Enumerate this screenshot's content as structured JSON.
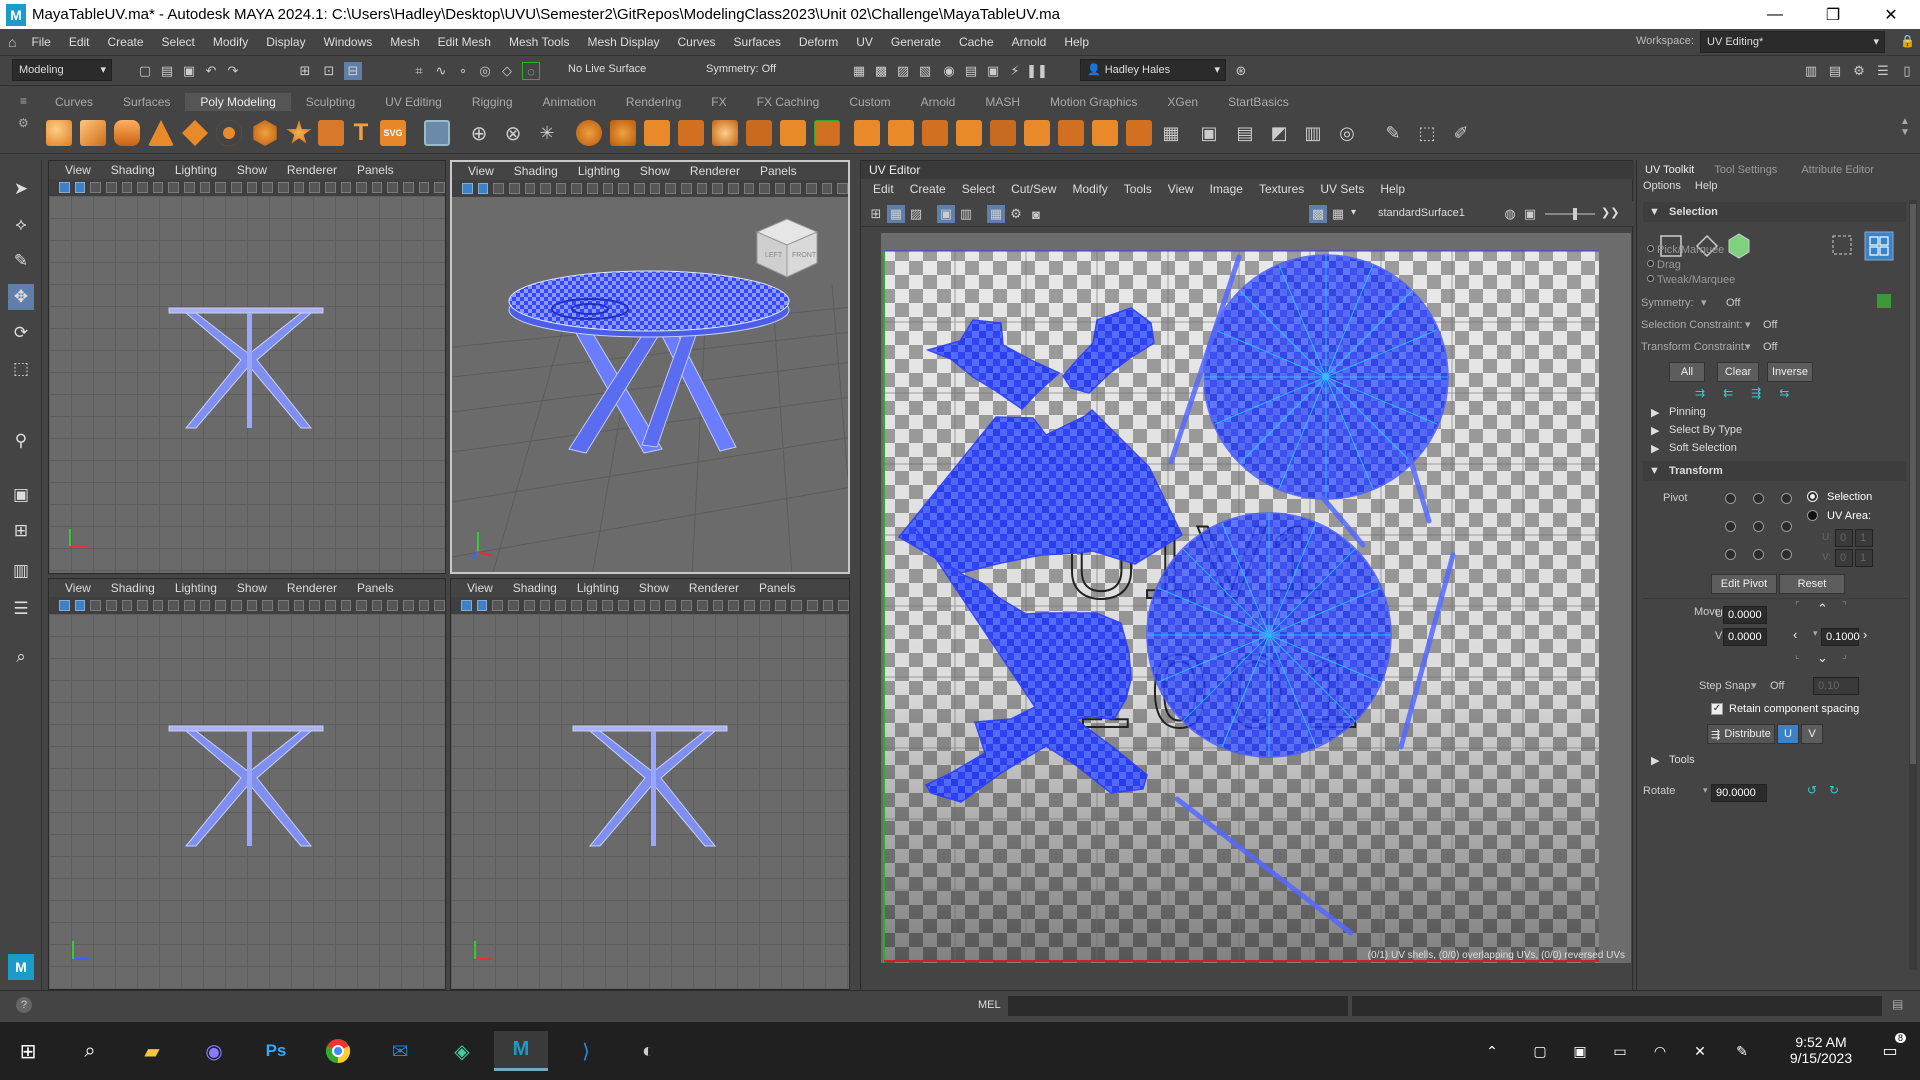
{
  "titlebar": {
    "title": "MayaTableUV.ma* - Autodesk MAYA 2024.1: C:\\Users\\Hadley\\Desktop\\UVU\\Semester2\\GitRepos\\ModelingClass2023\\Unit 02\\Challenge\\MayaTableUV.ma",
    "logo": "M",
    "minimize": "—",
    "restore": "❐",
    "close": "✕"
  },
  "menubar": {
    "items": [
      "File",
      "Edit",
      "Create",
      "Select",
      "Modify",
      "Display",
      "Windows",
      "Mesh",
      "Edit Mesh",
      "Mesh Tools",
      "Mesh Display",
      "Curves",
      "Surfaces",
      "Deform",
      "UV",
      "Generate",
      "Cache",
      "Arnold",
      "Help"
    ],
    "workspace_label": "Workspace:",
    "workspace_value": "UV Editing*"
  },
  "statusline": {
    "menuset": "Modeling",
    "live_surface": "No Live Surface",
    "symmetry": "Symmetry: Off",
    "user": "Hadley Hales"
  },
  "shelf": {
    "tabs": [
      "Curves",
      "Surfaces",
      "Poly Modeling",
      "Sculpting",
      "UV Editing",
      "Rigging",
      "Animation",
      "Rendering",
      "FX",
      "FX Caching",
      "Custom",
      "Arnold",
      "MASH",
      "Motion Graphics",
      "XGen",
      "StartBasics"
    ],
    "active": "Poly Modeling",
    "text_tool": "T",
    "svg_tool": "SVG"
  },
  "viewport_menu": [
    "View",
    "Shading",
    "Lighting",
    "Show",
    "Renderer",
    "Panels"
  ],
  "viewcube": {
    "left": "LEFT",
    "front": "FRONT"
  },
  "uv_editor": {
    "title": "UV Editor",
    "menu": [
      "Edit",
      "Create",
      "Select",
      "Cut/Sew",
      "Modify",
      "Tools",
      "View",
      "Image",
      "Textures",
      "UV Sets",
      "Help"
    ],
    "material": "standardSurface1",
    "checker_text_1": "U1V1",
    "checker_text_2": "1001",
    "status": "(0/1) UV shells, (0/0) overlapping UVs, (0/0) reversed UVs"
  },
  "toolkit": {
    "tabs": [
      "UV Toolkit",
      "Tool Settings",
      "Attribute Editor"
    ],
    "menu": [
      "Options",
      "Help"
    ],
    "selection_header": "Selection",
    "pick_modes": [
      "Pick/Marquee",
      "Drag",
      "Tweak/Marquee"
    ],
    "symmetry_label": "Symmetry:",
    "symmetry_value": "Off",
    "sel_constraint_label": "Selection Constraint:",
    "sel_constraint_value": "Off",
    "xform_constraint_label": "Transform Constraint:",
    "xform_constraint_value": "Off",
    "btn_all": "All",
    "btn_clear": "Clear",
    "btn_inverse": "Inverse",
    "sections": [
      "Pinning",
      "Select By Type",
      "Soft Selection"
    ],
    "transform_header": "Transform",
    "pivot_label": "Pivot",
    "pivot_selection": "Selection",
    "pivot_uv_area": "UV Area:",
    "pivot_u": "U:",
    "pivot_v": "V:",
    "pivot_u_val": "0",
    "pivot_u_val2": "1",
    "pivot_v_val": "0",
    "pivot_v_val2": "1",
    "edit_pivot": "Edit Pivot",
    "reset": "Reset",
    "move_label": "Move",
    "move_u_label": "U",
    "move_v_label": "V",
    "move_u": "0.0000",
    "move_v": "0.0000",
    "move_step": "0.1000",
    "step_snap_label": "Step Snap:",
    "step_snap_value": "Off",
    "step_snap_num": "0.10",
    "retain_spacing": "Retain component spacing",
    "distribute": "Distribute",
    "dist_u": "U",
    "dist_v": "V",
    "tools_header": "Tools",
    "rotate_label": "Rotate",
    "rotate_value": "90.0000"
  },
  "cmdline": {
    "label": "MEL",
    "help_icon": "?"
  },
  "taskbar": {
    "time": "9:52 AM",
    "date": "9/15/2023",
    "notifications": "8",
    "ps_label": "Ps"
  },
  "colors": {
    "uv_blue": "#2a3cff",
    "shell_fill": "#3a57ff",
    "accent": "#3c82c9"
  }
}
